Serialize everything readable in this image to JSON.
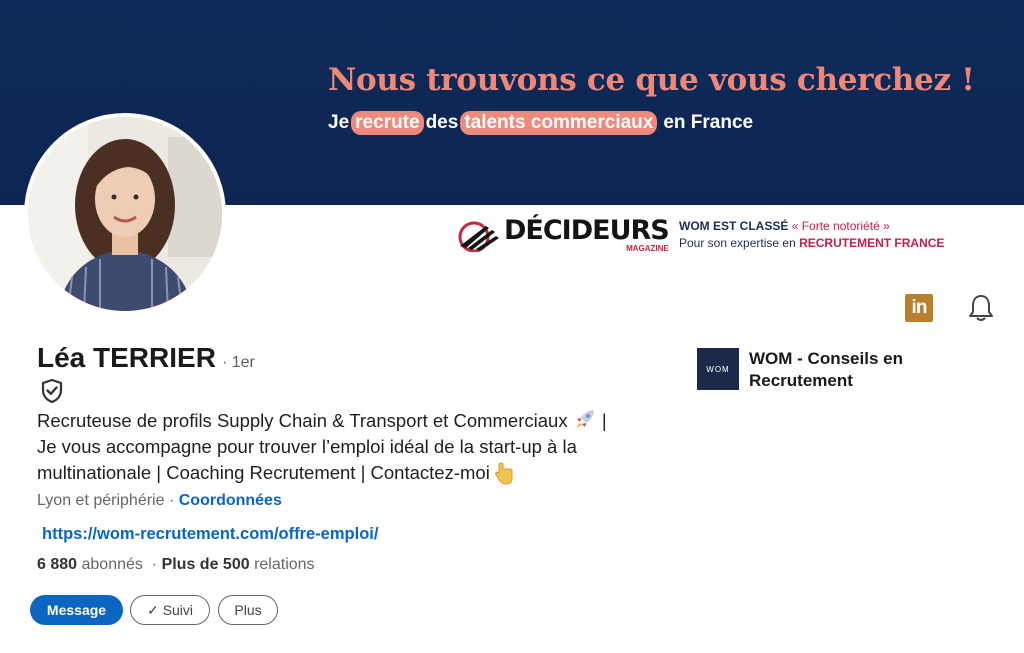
{
  "banner": {
    "headline": "Nous trouvons ce que vous cherchez !",
    "sub_prefix": "Je",
    "sub_pill1": "recrute",
    "sub_mid": "des",
    "sub_pill2": "talents commerciaux",
    "sub_suffix": "en France"
  },
  "award": {
    "logo_word": "DÉCIDEURS",
    "logo_sub": "MAGAZINE",
    "line1_bold": "WOM EST CLASSÉ",
    "line1_rest": "« Forte notoriété »",
    "line2_prefix": "Pour son expertise en",
    "line2_bold": "RECRUTEMENT FRANCE"
  },
  "profile": {
    "name": "Léa TERRIER",
    "degree": "· 1er",
    "headline_line1": "Recruteuse de profils Supply Chain & Transport et Commerciaux",
    "headline_line1_end": "|",
    "headline_line2": "Je vous accompagne pour trouver l’emploi idéal de la start-up à la",
    "headline_line3": "multinationale | Coaching Recrutement | Contactez-moi",
    "location": "Lyon et périphérie",
    "location_sep": "·",
    "contact_link": "Coordonnées",
    "website": "https://wom-recrutement.com/offre-emploi/",
    "followers_num": "6 880",
    "followers_label": "abonnés",
    "relations_sep": "·",
    "relations_num": "Plus de 500",
    "relations_label": "relations"
  },
  "icons": {
    "linkedin": "linkedin-icon",
    "bell": "bell-icon",
    "verified": "shield-check-icon",
    "rocket": "rocket-icon",
    "pointing": "pointing-down-icon",
    "linkedin_color": "#b8802e"
  },
  "company": {
    "logo_text": "WOM",
    "name": "WOM - Conseils en Recrutement"
  },
  "actions": {
    "message": "Message",
    "follow_check": "✓",
    "follow": "Suivi",
    "more": "Plus"
  },
  "colors": {
    "banner_bg": "#0d2552",
    "accent_coral": "#ee8a7c",
    "link_blue": "#0a66c2"
  }
}
